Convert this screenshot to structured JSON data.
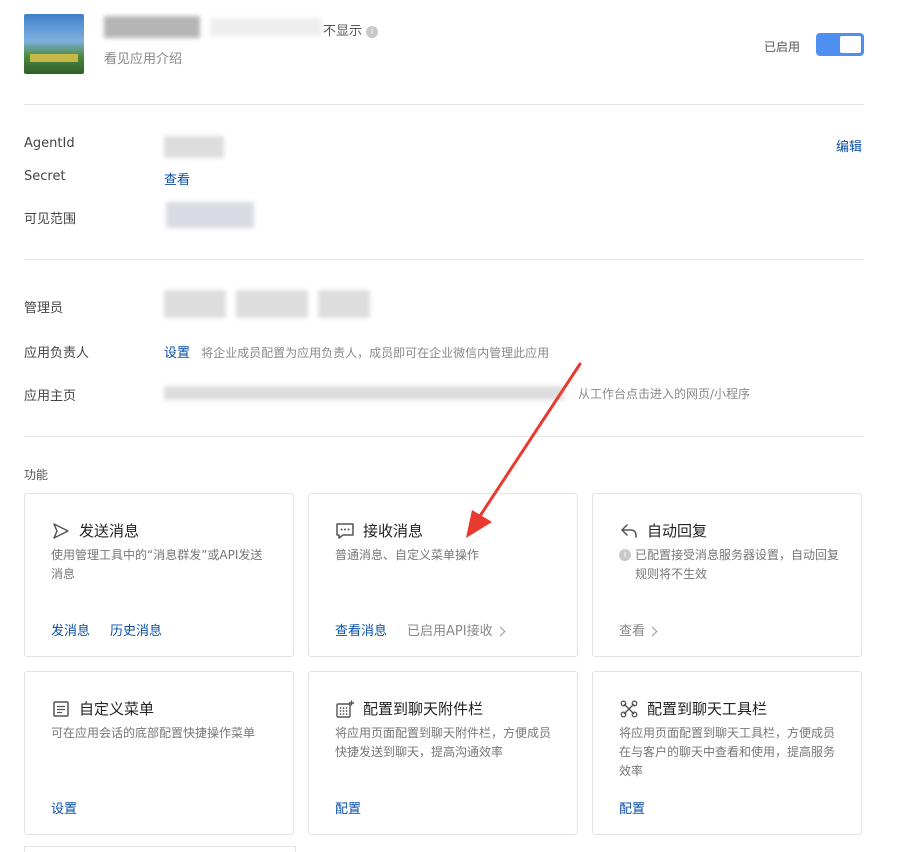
{
  "header": {
    "hidden_suffix": "不显示",
    "subtitle": "看见应用介绍",
    "status_label": "已启用"
  },
  "info": {
    "agentid_label": "AgentId",
    "edit_label": "编辑",
    "secret_label": "Secret",
    "secret_link": "查看",
    "visible_label": "可见范围"
  },
  "admin": {
    "managers_label": "管理员",
    "owner_label": "应用负责人",
    "owner_link": "设置",
    "owner_hint": "将企业成员配置为应用负责人，成员即可在企业微信内管理此应用",
    "homepage_label": "应用主页",
    "homepage_hint": "从工作台点击进入的网页/小程序"
  },
  "features": {
    "section_title": "功能",
    "cards": [
      {
        "title": "发送消息",
        "desc": "使用管理工具中的“消息群发”或API发送消息",
        "action1": "发消息",
        "action2": "历史消息"
      },
      {
        "title": "接收消息",
        "desc": "普通消息、自定义菜单操作",
        "action1": "查看消息",
        "action2": "已启用API接收"
      },
      {
        "title": "自动回复",
        "desc": "已配置接受消息服务器设置，自动回复规则将不生效",
        "action1": "查看"
      },
      {
        "title": "自定义菜单",
        "desc": "可在应用会话的底部配置快捷操作菜单",
        "action1": "设置"
      },
      {
        "title": "配置到聊天附件栏",
        "desc": "将应用页面配置到聊天附件栏，方便成员快捷发送到聊天，提高沟通效率",
        "action1": "配置"
      },
      {
        "title": "配置到聊天工具栏",
        "desc": "将应用页面配置到聊天工具栏，方便成员在与客户的聊天中查看和使用，提高服务效率",
        "action1": "配置"
      }
    ]
  },
  "colors": {
    "accent": "#4f8ff0",
    "link": "#0b4fa8",
    "arrow": "#e83a2e"
  }
}
